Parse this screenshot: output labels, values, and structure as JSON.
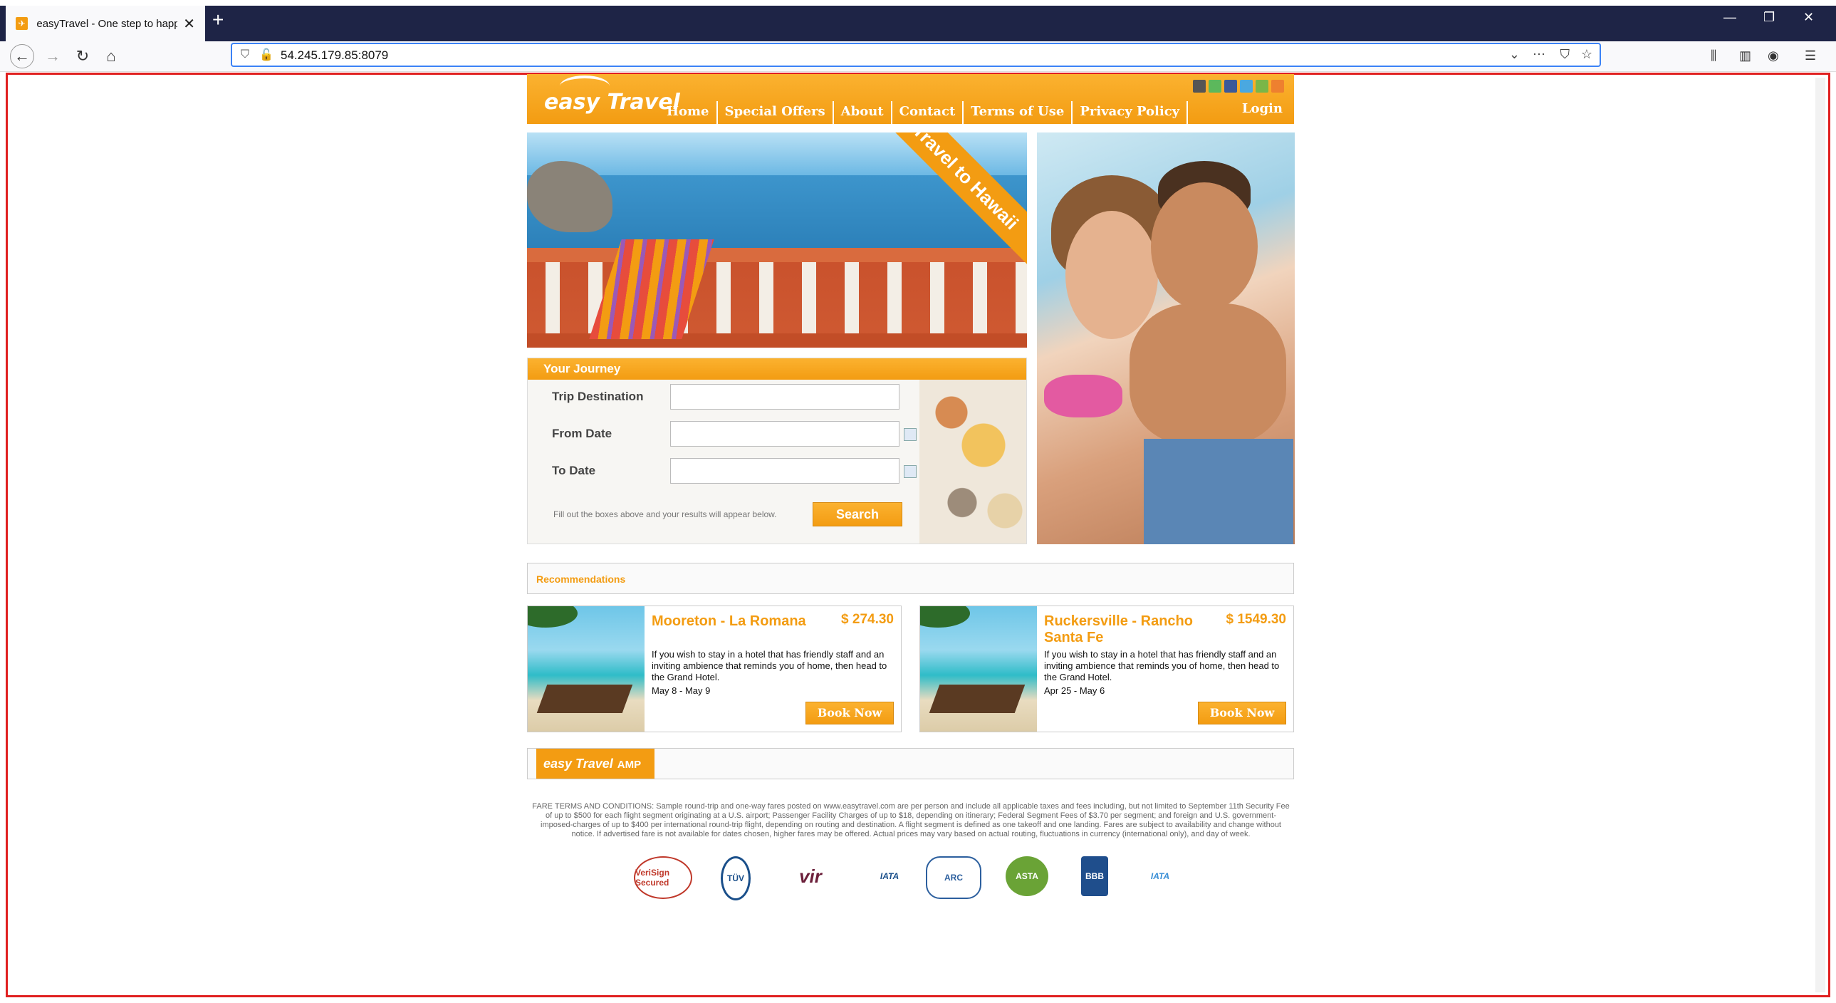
{
  "browser": {
    "tab_title": "easyTravel - One step to happiness",
    "url": "54.245.179.85:8079",
    "new_tab": "+",
    "close_tab": "✕"
  },
  "header": {
    "logo": "easy Travel",
    "menu": [
      "Home",
      "Special Offers",
      "About",
      "Contact",
      "Terms of Use",
      "Privacy Policy"
    ],
    "login": "Login"
  },
  "hero": {
    "banner": "Travel to Hawaii"
  },
  "journey": {
    "title": "Your Journey",
    "fields": [
      {
        "label": "Trip Destination",
        "value": ""
      },
      {
        "label": "From Date",
        "value": ""
      },
      {
        "label": "To Date",
        "value": ""
      }
    ],
    "hint": "Fill out the boxes above and your results will appear below.",
    "search": "Search"
  },
  "recommendations": {
    "title": "Recommendations",
    "cards": [
      {
        "destination": "Mooreton - La Romana",
        "price": "$ 274.30",
        "description": "If you wish to stay in a hotel that has friendly staff and an inviting ambience that reminds you of home, then head to the Grand Hotel.",
        "dates": "May 8 - May 9",
        "book": "Book Now"
      },
      {
        "destination": "Ruckersville - Rancho Santa Fe",
        "price": "$ 1549.30",
        "description": "If you wish to stay in a hotel that has friendly staff and an inviting ambience that reminds you of home, then head to the Grand Hotel.",
        "dates": "Apr 25 - May 6",
        "book": "Book Now"
      }
    ]
  },
  "amp": {
    "logo": "easy Travel",
    "suffix": "AMP"
  },
  "terms": "FARE TERMS AND CONDITIONS: Sample round-trip and one-way fares posted on www.easytravel.com are per person and include all applicable taxes and fees including, but not limited to September 11th Security Fee of up to $500 for each flight segment originating at a U.S. airport; Passenger Facility Charges of up to $18, depending on itinerary; Federal Segment Fees of $3.70 per segment; and foreign and U.S. government-imposed-charges of up to $400 per international round-trip flight, depending on routing and destination. A flight segment is defined as one takeoff and one landing. Fares are subject to availability and change without notice. If advertised fare is not available for dates chosen, higher fares may be offered. Actual prices may vary based on actual routing, fluctuations in currency (international only), and day of week.",
  "badges": [
    "VeriSign Secured",
    "TÜV",
    "vir",
    "IATA",
    "ARC",
    "ASTA",
    "BBB",
    "IATA"
  ],
  "colors": {
    "accent": "#f39c12",
    "tabbar": "#1e2446",
    "focus": "#3b82f6"
  }
}
